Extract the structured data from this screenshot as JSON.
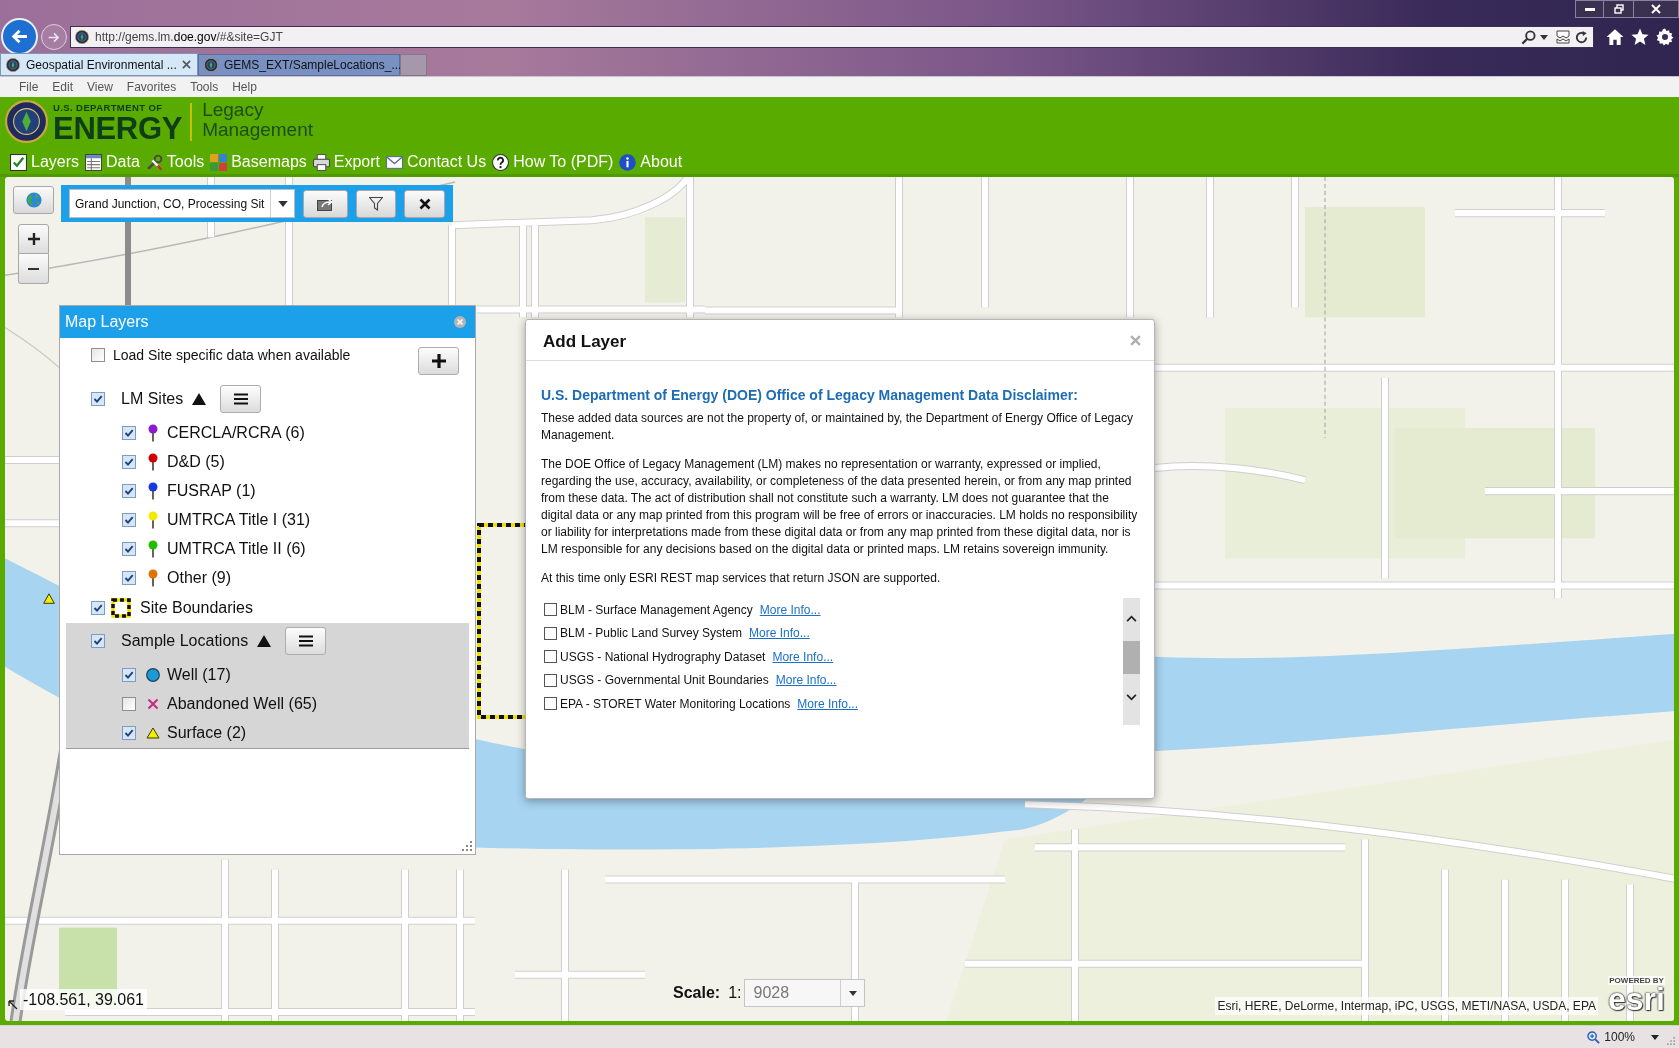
{
  "browser": {
    "url": "http://gems.lm.**doe.gov**/#&site=GJT",
    "tabs": [
      {
        "title": "Geospatial Environmental ...",
        "selected": true
      },
      {
        "title": "GEMS_EXT/SampleLocations_...",
        "selected": false
      }
    ],
    "menu": [
      "File",
      "Edit",
      "View",
      "Favorites",
      "Tools",
      "Help"
    ]
  },
  "header": {
    "department": "U.S. DEPARTMENT OF",
    "agency": "ENERGY",
    "office": [
      "Legacy",
      "Management"
    ],
    "nav": [
      {
        "kind": "layers",
        "label": "Layers"
      },
      {
        "kind": "data",
        "label": "Data"
      },
      {
        "kind": "tools",
        "label": "Tools"
      },
      {
        "kind": "basemaps",
        "label": "Basemaps"
      },
      {
        "kind": "export",
        "label": "Export"
      },
      {
        "kind": "contact",
        "label": "Contact Us"
      },
      {
        "kind": "howto",
        "label": "How To (PDF)"
      },
      {
        "kind": "about",
        "label": "About"
      }
    ]
  },
  "map_toolbar": {
    "site": "Grand Junction, CO, Processing Sit"
  },
  "layers_panel": {
    "title": "Map Layers",
    "load_site_data": {
      "label": "Load Site specific data when available",
      "checked": false
    },
    "groups": [
      {
        "kind": "group",
        "name": "LM Sites",
        "checked": true,
        "expanded": true,
        "selected": false,
        "children": [
          {
            "kind": "pin",
            "name": "CERCLA/RCRA (6)",
            "checked": true,
            "color": "#8e1ad6"
          },
          {
            "kind": "pin",
            "name": "D&D (5)",
            "checked": true,
            "color": "#d10000"
          },
          {
            "kind": "pin",
            "name": "FUSRAP (1)",
            "checked": true,
            "color": "#1638e0"
          },
          {
            "kind": "pin",
            "name": "UMTRCA Title I (31)",
            "checked": true,
            "color": "#f2ea00"
          },
          {
            "kind": "pin",
            "name": "UMTRCA Title II (6)",
            "checked": true,
            "color": "#1fbf00"
          },
          {
            "kind": "pin",
            "name": "Other (9)",
            "checked": true,
            "color": "#e07400"
          }
        ]
      },
      {
        "kind": "boundary",
        "name": "Site Boundaries",
        "checked": true,
        "selected": false
      },
      {
        "kind": "group",
        "name": "Sample Locations",
        "checked": true,
        "expanded": true,
        "selected": true,
        "children": [
          {
            "kind": "circle",
            "name": "Well (17)",
            "checked": true,
            "color": "#1a9ad6"
          },
          {
            "kind": "cross",
            "name": "Abandoned Well (65)",
            "checked": false,
            "color": "#c4308c"
          },
          {
            "kind": "triangle",
            "name": "Surface (2)",
            "checked": true,
            "color": "#f2f000"
          }
        ]
      }
    ]
  },
  "add_layer": {
    "title": "Add Layer",
    "heading": "U.S. Department of Energy (DOE) Office of Legacy Management Data Disclaimer:",
    "paragraphs": [
      "These added data sources are not the property of, or maintained by, the Department of Energy Office of Legacy Management.",
      "The DOE Office of Legacy Management (LM) makes no representation or warranty, expressed or implied, regarding the use, accuracy, availability, or completeness of the data presented herein, or from any map printed from these data. The act of distribution shall not constitute such a warranty. LM does not guarantee that the digital data or any map printed from this program will be free of errors or inaccuracies. LM holds no responsibility or liability for interpretations made from these digital data or from any map printed from these digital data, nor is LM responsible for any decisions based on the digital data or printed maps. LM retains sovereign immunity.",
      "At this time only ESRI REST map services that return JSON are supported."
    ],
    "services": [
      {
        "name": "BLM - Surface Management Agency",
        "checked": false,
        "link": "More Info..."
      },
      {
        "name": "BLM - Public Land Survey System",
        "checked": false,
        "link": "More Info..."
      },
      {
        "name": "USGS - National Hydrography Dataset",
        "checked": false,
        "link": "More Info..."
      },
      {
        "name": "USGS - Governmental Unit Boundaries",
        "checked": false,
        "link": "More Info..."
      },
      {
        "name": "EPA - STORET Water Monitoring Locations",
        "checked": false,
        "link": "More Info..."
      }
    ]
  },
  "map_footer": {
    "coordinates": "-108.561, 39.061",
    "scale_label": "Scale:",
    "scale_prefix": "1:",
    "scale_value": "9028",
    "attribution": "Esri, HERE, DeLorme, Intermap, iPC, USGS, METI/NASA, USDA, EPA",
    "logo_tagline": "POWERED BY",
    "logo": "esri"
  },
  "status_bar": {
    "zoom": "100%"
  }
}
